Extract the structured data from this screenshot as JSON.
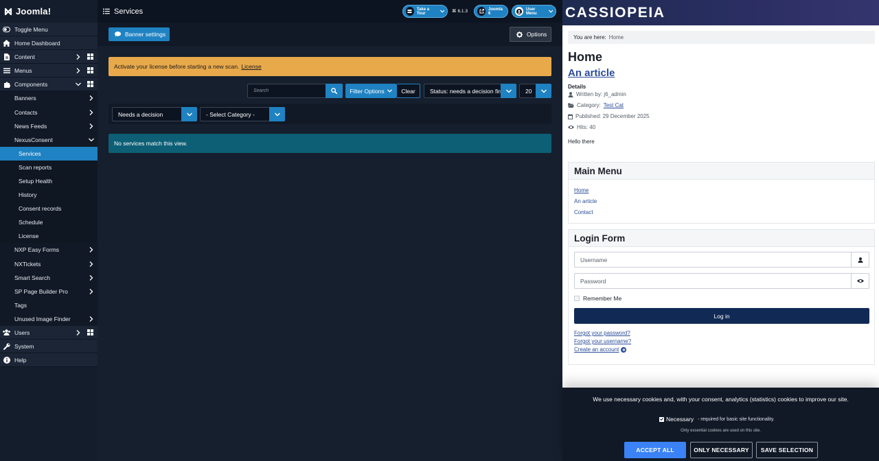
{
  "admin": {
    "brand": "Joomla!",
    "page_title": "Services",
    "take_tour": "Take a Tour",
    "version": "6.1.3",
    "site_link": "Joomla 6",
    "user_menu": "User Menu",
    "toggle_menu": "Toggle Menu",
    "nav": [
      {
        "label": "Home Dashboard"
      },
      {
        "label": "Content"
      },
      {
        "label": "Menus"
      },
      {
        "label": "Components"
      },
      {
        "label": "Banners"
      },
      {
        "label": "Contacts"
      },
      {
        "label": "News Feeds"
      },
      {
        "label": "NexusConsent"
      },
      {
        "label": "Services"
      },
      {
        "label": "Scan reports"
      },
      {
        "label": "Setup Health"
      },
      {
        "label": "History"
      },
      {
        "label": "Consent records"
      },
      {
        "label": "Schedule"
      },
      {
        "label": "License"
      },
      {
        "label": "NXP Easy Forms"
      },
      {
        "label": "NXTickets"
      },
      {
        "label": "Smart Search"
      },
      {
        "label": "SP Page Builder Pro"
      },
      {
        "label": "Tags"
      },
      {
        "label": "Unused Image Finder"
      },
      {
        "label": "Users"
      },
      {
        "label": "System"
      },
      {
        "label": "Help"
      }
    ],
    "toolbar": {
      "banner_settings": "Banner settings",
      "options": "Options"
    },
    "alert": {
      "text": "Activate your license before starting a new scan.",
      "link": "License"
    },
    "filters": {
      "search_placeholder": "Search",
      "filter_options": "Filter Options",
      "clear": "Clear",
      "status": "Status: needs a decision first",
      "limit": "20",
      "decision": "Needs a decision",
      "category": "- Select Category -"
    },
    "no_results": "No services match this view."
  },
  "site": {
    "brand": "CASSIOPEIA",
    "breadcrumb_label": "You are here:",
    "breadcrumb_home": "Home",
    "heading": "Home",
    "article_title": "An article",
    "details_label": "Details",
    "written_by": "Written by: j6_admin",
    "category_label": "Category:",
    "category_value": "Test Cat",
    "published": "Published: 29 December 2025",
    "hits": "Hits: 40",
    "intro": "Hello there",
    "main_menu": {
      "title": "Main Menu",
      "items": [
        "Home",
        "An article",
        "Contact"
      ]
    },
    "login": {
      "title": "Login Form",
      "username_placeholder": "Username",
      "password_placeholder": "Password",
      "remember": "Remember Me",
      "submit": "Log in",
      "forgot_password": "Forgot your password?",
      "forgot_username": "Forgot your username?",
      "create_account": "Create an account"
    }
  },
  "cookie": {
    "message": "We use necessary cookies and, with your consent, analytics (statistics) cookies to improve our site.",
    "necessary_label": "Necessary",
    "necessary_desc": "- required for basic site functionality.",
    "note": "Only essential cookies are used on this site.",
    "accept_all": "ACCEPT ALL",
    "only_necessary": "ONLY NECESSARY",
    "save_selection": "SAVE SELECTION"
  },
  "colors": {
    "admin_accent": "#1f82c2",
    "alert_warning": "#e8a94b",
    "site_button": "#112a55",
    "accept_button": "#3b82f6"
  }
}
